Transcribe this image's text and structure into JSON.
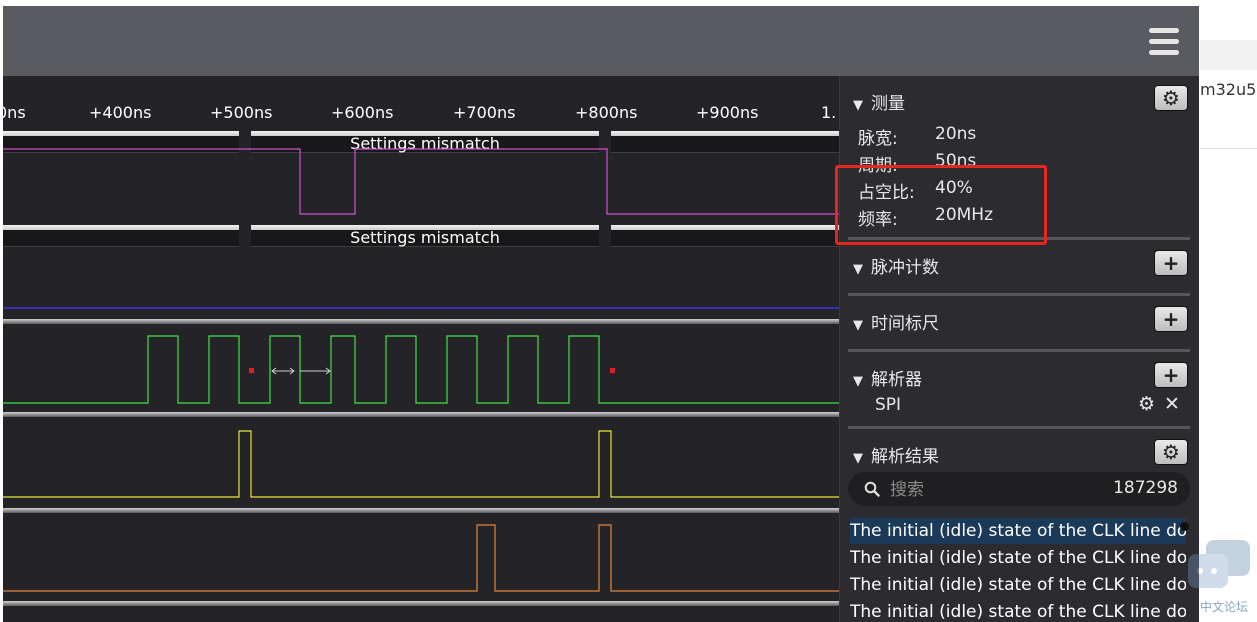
{
  "ruler": {
    "ticks": [
      "0ns",
      "+400ns",
      "+500ns",
      "+600ns",
      "+700ns",
      "+800ns",
      "+900ns",
      "1."
    ]
  },
  "channels": {
    "decoder_label_1": "Settings mismatch",
    "decoder_label_2": "Settings mismatch",
    "colors": {
      "magenta": "#d24fd2",
      "blue": "#3a3aff",
      "green": "#3fe33f",
      "yellow": "#e8e23a",
      "orange": "#e8823a",
      "marker": "#e02020"
    }
  },
  "panel": {
    "measure": {
      "title": "测量",
      "rows": [
        {
          "label": "脉宽:",
          "value": "20ns"
        },
        {
          "label": "周期:",
          "value": "50ns"
        },
        {
          "label": "占空比:",
          "value": "40%"
        },
        {
          "label": "频率:",
          "value": "20MHz"
        }
      ]
    },
    "pulse_count": {
      "title": "脉冲计数"
    },
    "time_ruler": {
      "title": "时间标尺"
    },
    "analyzers": {
      "title": "解析器",
      "items": [
        "SPI"
      ]
    },
    "results": {
      "title": "解析结果",
      "search_placeholder": "搜索",
      "count": "187298",
      "rows": [
        "The initial (idle) state of the CLK line do...",
        "The initial (idle) state of the CLK line do...",
        "The initial (idle) state of the CLK line do...",
        "The initial (idle) state of the CLK line do..."
      ]
    }
  },
  "background": {
    "partial_text": "m32u5",
    "watermark_text": "中文论坛"
  },
  "icons": {
    "menu": "hamburger-icon",
    "gear": "gear-icon",
    "add": "plus-icon",
    "close": "close-icon",
    "search": "search-icon",
    "collapse": "triangle-down-icon"
  }
}
